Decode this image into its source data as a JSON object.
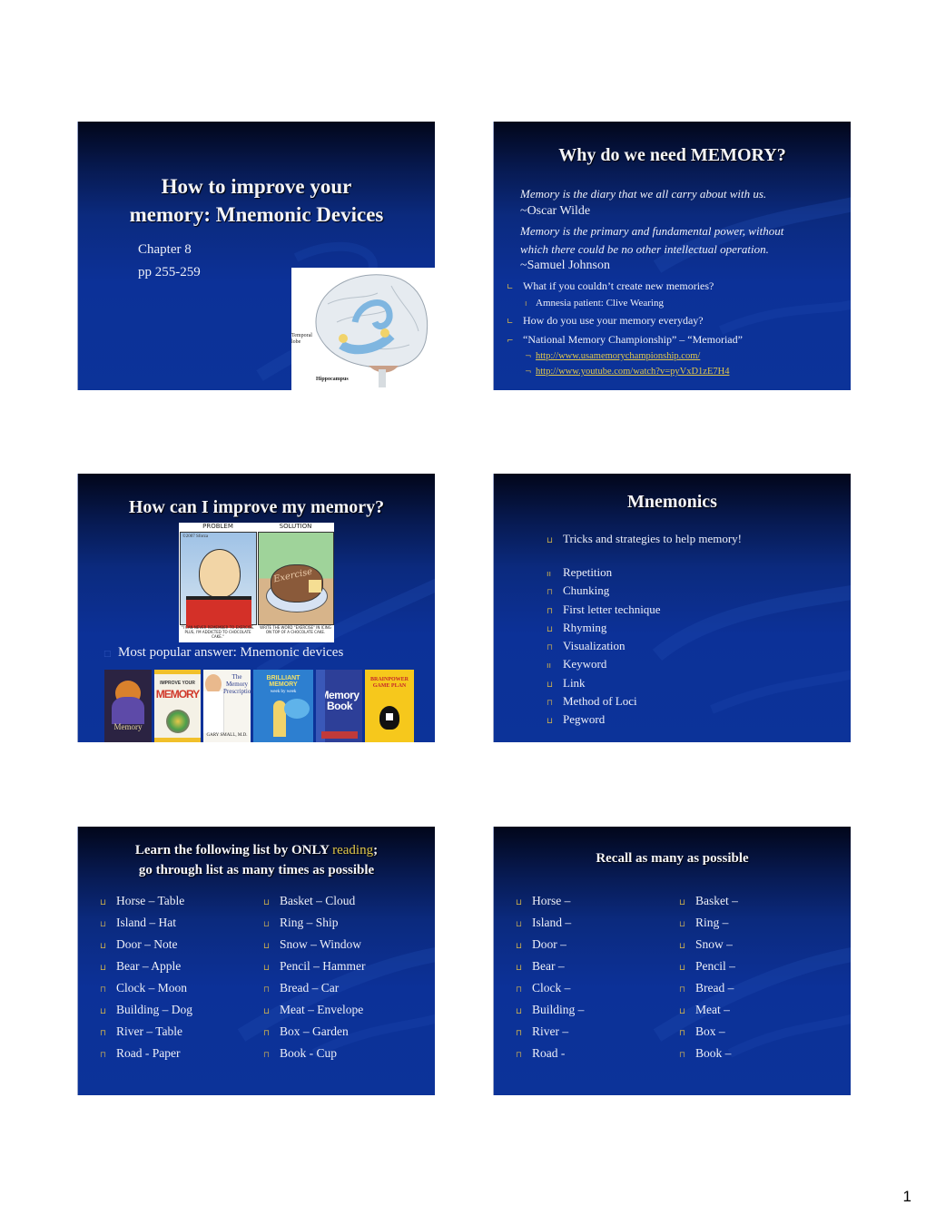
{
  "page_number": "1",
  "colors": {
    "slide_bg_top": "#02061a",
    "slide_bg": "#0c3399",
    "bullet": "#d9b94a",
    "link": "#e1c84c",
    "highlight": "#e1c84c"
  },
  "slides": [
    {
      "title_line1": "How to improve your",
      "title_line2": "memory: Mnemonic Devices",
      "subtitle1": "Chapter 8",
      "subtitle2": "pp 255-259",
      "image": {
        "label_temporal_line1": "Temporal",
        "label_temporal_line2": "lobe",
        "label_hippocampus": "Hippocampus"
      }
    },
    {
      "title": "Why do we need MEMORY?",
      "quote1": "Memory is the diary that we all carry about with us.",
      "quote1_author": "~Oscar Wilde",
      "quote2_line1": "Memory is the primary and fundamental power, without",
      "quote2_line2": "which there could be no other intellectual operation.",
      "quote2_author": "~Samuel Johnson",
      "bullet1": "What if you couldn’t create new memories?",
      "sub1": "Amnesia patient: Clive Wearing",
      "bullet2": "How do you use your memory everyday?",
      "bullet3": "“National Memory Championship” – “Memoriad”",
      "link1": "http://www.usamemorychampionship.com/",
      "link2": "http://www.youtube.com/watch?v=pyVxD1zE7H4"
    },
    {
      "title": "How can I improve my memory?",
      "comic": {
        "problem_label": "PROBLEM",
        "solution_label": "SOLUTION",
        "signature": "©2007 Sforza",
        "cake_text": "Exercise",
        "caption_left": "\"I CAN NEVER REMEMBER TO EXERCISE. PLUS, I'M ADDICTED TO CHOCOLATE CAKE.\"",
        "caption_right": "WRITE THE WORD \"EXERCISE\" IN ICING ON TOP OF A CHOCOLATE CAKE."
      },
      "bullet": "Most popular answer: Mnemonic devices",
      "books": [
        {
          "title": "Memory",
          "bg": "#2b2342",
          "fg": "#e9d9a0"
        },
        {
          "title": "MEMORY",
          "sub": "IMPROVE YOUR",
          "bg": "#f1c02a",
          "fg": "#d1392b"
        },
        {
          "title": "The Memory Prescription",
          "sub": "GARY SMALL, M.D.",
          "bg": "#f4f1ea",
          "fg": "#2a3a8a"
        },
        {
          "title": "BRILLIANT MEMORY",
          "sub": "week by week",
          "bg": "#2d7fd0",
          "fg": "#ffffff"
        },
        {
          "title": "Memory Book",
          "bg": "#2d3f98",
          "fg": "#ffffff"
        },
        {
          "title": "BRAINPOWER GAME PLAN",
          "bg": "#f6c81c",
          "fg": "#c6252b"
        }
      ]
    },
    {
      "title": "Mnemonics",
      "intro": "Tricks and strategies to help memory!",
      "items": [
        "Repetition",
        "Chunking",
        "First letter technique",
        "Rhyming",
        "Visualization",
        "Keyword",
        "Link",
        "Method of Loci",
        "Pegword"
      ]
    },
    {
      "title_line1_a": "Learn the following list by ONLY ",
      "title_line1_b": "reading",
      "title_line1_c": ";",
      "title_line2": "go through list as many times as possible",
      "left": [
        "Horse – Table",
        "Island – Hat",
        "Door – Note",
        "Bear – Apple",
        "Clock – Moon",
        "Building – Dog",
        "River – Table",
        "Road - Paper"
      ],
      "right": [
        "Basket – Cloud",
        "Ring – Ship",
        "Snow – Window",
        "Pencil – Hammer",
        "Bread – Car",
        "Meat – Envelope",
        "Box – Garden",
        "Book - Cup"
      ]
    },
    {
      "title": "Recall as many as possible",
      "left": [
        "Horse –",
        "Island –",
        "Door –",
        "Bear –",
        "Clock –",
        "Building –",
        "River –",
        "Road -"
      ],
      "right": [
        "Basket –",
        "Ring –",
        "Snow –",
        "Pencil –",
        "Bread –",
        "Meat –",
        "Box –",
        "Book –"
      ]
    }
  ]
}
